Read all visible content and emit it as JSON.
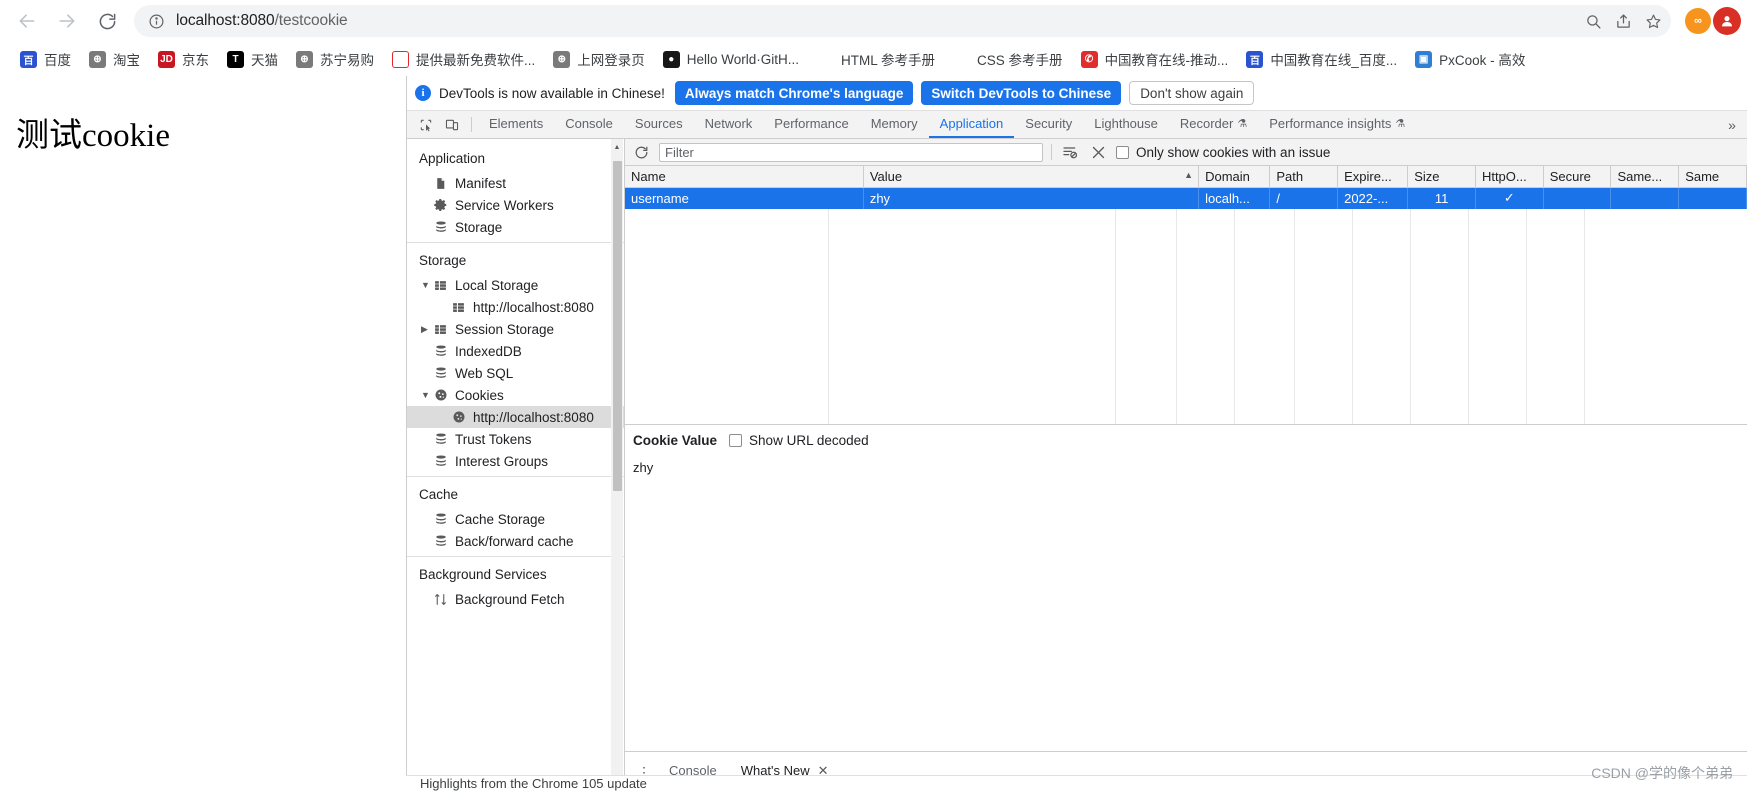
{
  "browser": {
    "nav": {
      "back": "back-arrow",
      "forward": "forward-arrow",
      "reload": "reload"
    },
    "omnibox": {
      "host": "localhost:8080",
      "path": "/testcookie",
      "full_url": "localhost:8080/testcookie",
      "info_icon": "info-circle-icon",
      "zoom_icon": "zoom-search-icon",
      "share_icon": "share-icon",
      "star_icon": "star-bookmark-icon"
    },
    "extensions": [
      {
        "name": "infinity-extension",
        "glyph": "∞"
      }
    ],
    "profile": {
      "name": "profile-avatar",
      "glyph": "●"
    }
  },
  "bookmarks": [
    {
      "label": "百度",
      "icon": "baidu-icon",
      "glyph": "百",
      "cls": "ico-baidu"
    },
    {
      "label": "淘宝",
      "icon": "globe-icon",
      "glyph": "⊕",
      "cls": "ico-globe"
    },
    {
      "label": "京东",
      "icon": "jd-icon",
      "glyph": "JD",
      "cls": "ico-jd"
    },
    {
      "label": "天猫",
      "icon": "tmall-icon",
      "glyph": "T",
      "cls": "ico-tmall"
    },
    {
      "label": "苏宁易购",
      "icon": "globe-icon",
      "glyph": "⊕",
      "cls": "ico-globe"
    },
    {
      "label": "提供最新免费软件...",
      "icon": "udown-icon",
      "glyph": "U",
      "cls": "ico-u"
    },
    {
      "label": "上网登录页",
      "icon": "globe-icon",
      "glyph": "⊕",
      "cls": "ico-globe"
    },
    {
      "label": "Hello World·GitH...",
      "icon": "github-icon",
      "glyph": "●",
      "cls": "ico-gh"
    },
    {
      "label": "HTML 参考手册",
      "icon": "w3school-icon",
      "glyph": "3",
      "cls": "ico-w3"
    },
    {
      "label": "CSS 参考手册",
      "icon": "w3school-icon",
      "glyph": "3",
      "cls": "ico-w3"
    },
    {
      "label": "中国教育在线-推动...",
      "icon": "eol-icon",
      "glyph": "✆",
      "cls": "ico-eol"
    },
    {
      "label": "中国教育在线_百度...",
      "icon": "baidu-icon",
      "glyph": "百",
      "cls": "ico-baidu"
    },
    {
      "label": "PxCook - 高效",
      "icon": "pxcook-icon",
      "glyph": "▣",
      "cls": "ico-px"
    }
  ],
  "page": {
    "heading": "测试cookie"
  },
  "devtools": {
    "infobar": {
      "icon": "info-icon",
      "message": "DevTools is now available in Chinese!",
      "primary_button": "Always match Chrome's language",
      "secondary_button": "Switch DevTools to Chinese",
      "dismiss_button": "Don't show again"
    },
    "toolbar_icons": {
      "inspect": "inspect-element-icon",
      "device": "device-toolbar-icon",
      "more": "more-tabs-chevron-icon"
    },
    "tabs": [
      {
        "label": "Elements",
        "active": false,
        "experiment": false
      },
      {
        "label": "Console",
        "active": false,
        "experiment": false
      },
      {
        "label": "Sources",
        "active": false,
        "experiment": false
      },
      {
        "label": "Network",
        "active": false,
        "experiment": false
      },
      {
        "label": "Performance",
        "active": false,
        "experiment": false
      },
      {
        "label": "Memory",
        "active": false,
        "experiment": false
      },
      {
        "label": "Application",
        "active": true,
        "experiment": false
      },
      {
        "label": "Security",
        "active": false,
        "experiment": false
      },
      {
        "label": "Lighthouse",
        "active": false,
        "experiment": false
      },
      {
        "label": "Recorder",
        "active": false,
        "experiment": true
      },
      {
        "label": "Performance insights",
        "active": false,
        "experiment": true
      }
    ],
    "sidebar": {
      "sections": [
        {
          "title": "Application",
          "items": [
            {
              "label": "Manifest",
              "icon": "manifest-document-icon",
              "glyph": "Ὄ4",
              "indent": 1,
              "twisty": "",
              "selected": false
            },
            {
              "label": "Service Workers",
              "icon": "gear-icon",
              "glyph": "⚙",
              "indent": 1,
              "twisty": "",
              "selected": false
            },
            {
              "label": "Storage",
              "icon": "database-icon",
              "glyph": "≣",
              "indent": 1,
              "twisty": "",
              "selected": false
            }
          ]
        },
        {
          "title": "Storage",
          "items": [
            {
              "label": "Local Storage",
              "icon": "table-grid-icon",
              "glyph": "▒",
              "indent": 1,
              "twisty": "▼",
              "selected": false
            },
            {
              "label": "http://localhost:8080",
              "icon": "table-grid-icon",
              "glyph": "▒",
              "indent": 2,
              "twisty": "",
              "selected": false
            },
            {
              "label": "Session Storage",
              "icon": "table-grid-icon",
              "glyph": "▒",
              "indent": 1,
              "twisty": "▶",
              "selected": false
            },
            {
              "label": "IndexedDB",
              "icon": "database-icon",
              "glyph": "≣",
              "indent": 1,
              "twisty": "",
              "selected": false
            },
            {
              "label": "Web SQL",
              "icon": "database-icon",
              "glyph": "≣",
              "indent": 1,
              "twisty": "",
              "selected": false
            },
            {
              "label": "Cookies",
              "icon": "cookie-icon",
              "glyph": "●",
              "indent": 1,
              "twisty": "▼",
              "selected": false
            },
            {
              "label": "http://localhost:8080",
              "icon": "cookie-icon",
              "glyph": "●",
              "indent": 2,
              "twisty": "",
              "selected": true
            },
            {
              "label": "Trust Tokens",
              "icon": "database-icon",
              "glyph": "≣",
              "indent": 1,
              "twisty": "",
              "selected": false
            },
            {
              "label": "Interest Groups",
              "icon": "database-icon",
              "glyph": "≣",
              "indent": 1,
              "twisty": "",
              "selected": false
            }
          ]
        },
        {
          "title": "Cache",
          "items": [
            {
              "label": "Cache Storage",
              "icon": "database-icon",
              "glyph": "≣",
              "indent": 1,
              "twisty": "",
              "selected": false
            },
            {
              "label": "Back/forward cache",
              "icon": "database-icon",
              "glyph": "≣",
              "indent": 1,
              "twisty": "",
              "selected": false
            }
          ]
        },
        {
          "title": "Background Services",
          "items": [
            {
              "label": "Background Fetch",
              "icon": "background-fetch-icon",
              "glyph": "⇅",
              "indent": 1,
              "twisty": "",
              "selected": false
            }
          ]
        }
      ]
    },
    "cookies_toolbar": {
      "refresh_icon": "refresh-icon",
      "filter_placeholder": "Filter",
      "filter_value": "",
      "clear_filtered_icon": "clear-filtered-cookies-icon",
      "clear_all_icon": "clear-all-cookies-x-icon",
      "issue_checkbox_label": "Only show cookies with an issue",
      "issue_checkbox_checked": false
    },
    "cookies_table": {
      "columns": [
        {
          "label": "Name",
          "sorted": false
        },
        {
          "label": "Value",
          "sorted": true,
          "sort_glyph": "▲"
        },
        {
          "label": "Domain",
          "sorted": false
        },
        {
          "label": "Path",
          "sorted": false
        },
        {
          "label": "Expire...",
          "sorted": false
        },
        {
          "label": "Size",
          "sorted": false
        },
        {
          "label": "HttpO...",
          "sorted": false
        },
        {
          "label": "Secure",
          "sorted": false
        },
        {
          "label": "Same...",
          "sorted": false
        },
        {
          "label": "Same",
          "sorted": false
        }
      ],
      "rows": [
        {
          "selected": true,
          "name": "username",
          "value": "zhy",
          "domain": "localh...",
          "path": "/",
          "expires": "2022-...",
          "size": "11",
          "httponly": "✓",
          "secure": "",
          "samesite": "",
          "samepartykey": ""
        }
      ]
    },
    "cookie_preview": {
      "title": "Cookie Value",
      "show_url_decoded_label": "Show URL decoded",
      "show_url_decoded_checked": false,
      "value": "zhy"
    },
    "drawer": {
      "menu_icon": "drawer-menu-icon",
      "tabs": [
        {
          "label": "Console",
          "active": false,
          "closable": false
        },
        {
          "label": "What's New",
          "active": true,
          "closable": true,
          "close_glyph": "✕"
        }
      ],
      "content": "Highlights from the Chrome 105 update"
    }
  },
  "watermark": "CSDN @学的像个弟弟"
}
